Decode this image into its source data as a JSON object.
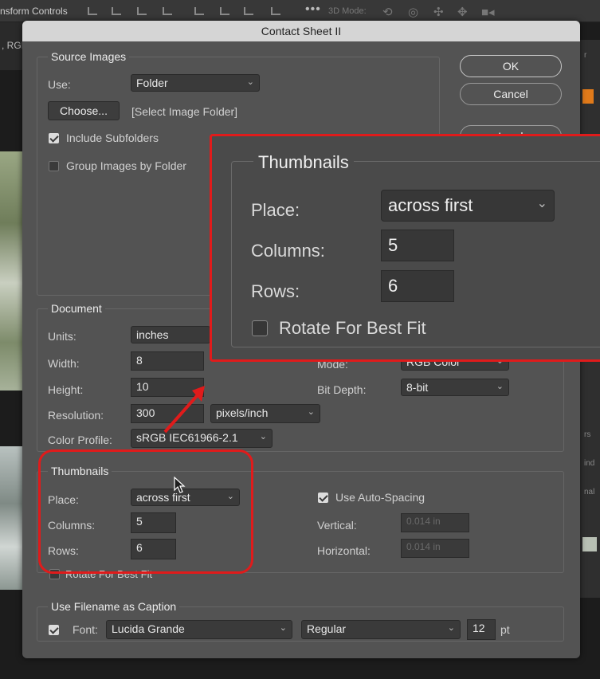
{
  "options_bar": {
    "label": "nsform Controls",
    "mode_label": "3D Mode:",
    "more": "•••"
  },
  "doc_tab": {
    "label": ", RGI"
  },
  "dialog": {
    "title": "Contact Sheet II",
    "buttons": {
      "ok": "OK",
      "cancel": "Cancel",
      "load": "Load"
    },
    "source": {
      "legend": "Source Images",
      "use_label": "Use:",
      "use_value": "Folder",
      "choose_label": "Choose...",
      "folder_path": "[Select Image Folder]",
      "include_subfolders": "Include Subfolders",
      "include_subfolders_checked": true,
      "group_by_folder": "Group Images by Folder",
      "group_by_folder_checked": false
    },
    "document": {
      "legend": "Document",
      "units_label": "Units:",
      "units_value": "inches",
      "width_label": "Width:",
      "width_value": "8",
      "height_label": "Height:",
      "height_value": "10",
      "resolution_label": "Resolution:",
      "resolution_value": "300",
      "resolution_unit": "pixels/inch",
      "profile_label": "Color Profile:",
      "profile_value": "sRGB IEC61966-2.1",
      "mode_label": "Mode:",
      "mode_value": "RGB Color",
      "bitdepth_label": "Bit Depth:",
      "bitdepth_value": "8-bit"
    },
    "thumbnails": {
      "legend": "Thumbnails",
      "place_label": "Place:",
      "place_value": "across first",
      "columns_label": "Columns:",
      "columns_value": "5",
      "rows_label": "Rows:",
      "rows_value": "6",
      "rotate_label": "Rotate For Best Fit",
      "rotate_checked": false,
      "auto_spacing_label": "Use Auto-Spacing",
      "auto_spacing_checked": true,
      "vertical_label": "Vertical:",
      "vertical_value": "0.014 in",
      "horizontal_label": "Horizontal:",
      "horizontal_value": "0.014 in"
    },
    "caption": {
      "legend": "Use Filename as Caption",
      "enabled": true,
      "font_label": "Font:",
      "font_value": "Lucida Grande",
      "style_value": "Regular",
      "size_value": "12",
      "size_unit": "pt"
    }
  },
  "zoom_callout": {
    "legend": "Thumbnails",
    "place_label": "Place:",
    "place_value": "across first",
    "columns_label": "Columns:",
    "columns_value": "5",
    "rows_label": "Rows:",
    "rows_value": "6",
    "rotate_label": "Rotate For Best Fit"
  },
  "right_panel": {
    "rs": "rs",
    "ind": "ind",
    "nal": "nal",
    "r": "r"
  },
  "colors": {
    "highlight": "#e01b1b",
    "dialog_bg": "#535353",
    "title_bar": "#d5d5d5"
  }
}
